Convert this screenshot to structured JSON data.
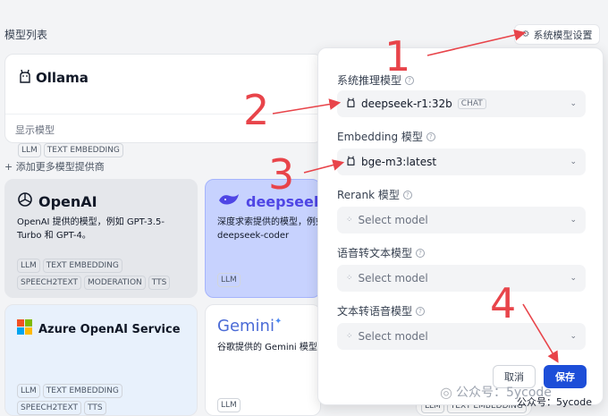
{
  "page": {
    "title": "模型列表",
    "add_more": "+ 添加更多模型提供商"
  },
  "system_settings_button": {
    "label": "系统模型设置",
    "icon": "gear-icon"
  },
  "ollama": {
    "name": "Ollama",
    "icon": "llama-icon",
    "tags": [
      "LLM",
      "TEXT EMBEDDING"
    ],
    "show_models": "显示模型"
  },
  "providers": [
    {
      "name": "OpenAI",
      "icon": "openai-icon",
      "desc": "OpenAI 提供的模型，例如 GPT-3.5-Turbo 和 GPT-4。",
      "tags": [
        "LLM",
        "TEXT EMBEDDING",
        "SPEECH2TEXT",
        "MODERATION",
        "TTS"
      ]
    },
    {
      "name": "deepseek",
      "icon": "whale-icon",
      "desc": "深度求索提供的模型，例如 deepseek-chat、deepseek-coder",
      "tags": [
        "LLM"
      ]
    },
    {
      "name": "Azure OpenAI Service",
      "icon": "microsoft-icon",
      "desc": "",
      "tags": [
        "LLM",
        "TEXT EMBEDDING",
        "SPEECH2TEXT",
        "TTS"
      ]
    },
    {
      "name": "Gemini",
      "icon": "gemini-icon",
      "desc": "谷歌提供的 Gemini 模型",
      "tags": [
        "LLM"
      ]
    },
    {
      "name": "",
      "icon": "",
      "desc": "",
      "tags": [
        "LLM",
        "TEXT EMBEDDING"
      ]
    }
  ],
  "panel": {
    "fields": [
      {
        "label": "系统推理模型",
        "value": "deepseek-r1:32b",
        "badge": "CHAT"
      },
      {
        "label": "Embedding 模型",
        "value": "bge-m3:latest",
        "badge": ""
      },
      {
        "label": "Rerank 模型",
        "value": "",
        "placeholder": "Select model"
      },
      {
        "label": "语音转文本模型",
        "value": "",
        "placeholder": "Select model"
      },
      {
        "label": "文本转语音模型",
        "value": "",
        "placeholder": "Select model"
      }
    ],
    "cancel": "取消",
    "save": "保存"
  },
  "annotations": [
    "1",
    "2",
    "3",
    "4"
  ],
  "watermark": {
    "text": "公众号：5ycode",
    "text2": "公众号：5ycode"
  },
  "colors": {
    "accent": "#1d4ed8",
    "annotation": "#e8444a"
  }
}
